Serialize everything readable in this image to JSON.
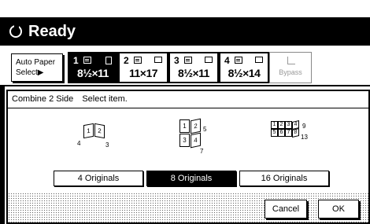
{
  "title": "Ready",
  "auto_paper": {
    "line1": "Auto Paper",
    "line2": "Select▶"
  },
  "trays": [
    {
      "num": "1",
      "size": "8½×11",
      "selected": true
    },
    {
      "num": "2",
      "size": "11×17",
      "selected": false
    },
    {
      "num": "3",
      "size": "8½×11",
      "selected": false
    },
    {
      "num": "4",
      "size": "8½×14",
      "selected": false
    }
  ],
  "bypass_label": "Bypass",
  "panel": {
    "label": "Combine 2 Side",
    "instruction": "Select item."
  },
  "options": [
    {
      "label": "4 Originals",
      "selected": false,
      "icon": "combine-4-icon"
    },
    {
      "label": "8 Originals",
      "selected": true,
      "icon": "combine-8-icon"
    },
    {
      "label": "16 Originals",
      "selected": false,
      "icon": "combine-16-icon"
    }
  ],
  "diagram_labels": {
    "four": {
      "p1": "1",
      "p2": "2",
      "left": "4",
      "right": "3"
    },
    "eight": {
      "p1": "1",
      "p2": "2",
      "p3": "3",
      "p4": "4",
      "right_top": "5",
      "right_bottom": "7"
    },
    "sixteen": {
      "p1": "1",
      "p2": "2",
      "p3": "3",
      "p4": "4",
      "p5": "5",
      "p6": "6",
      "p7": "7",
      "p8": "8",
      "right_top": "9",
      "right_bottom": "13"
    }
  },
  "buttons": {
    "cancel": "Cancel",
    "ok": "OK"
  },
  "colors": {
    "selected_bg": "#000000",
    "selected_text": "#ffffff"
  }
}
